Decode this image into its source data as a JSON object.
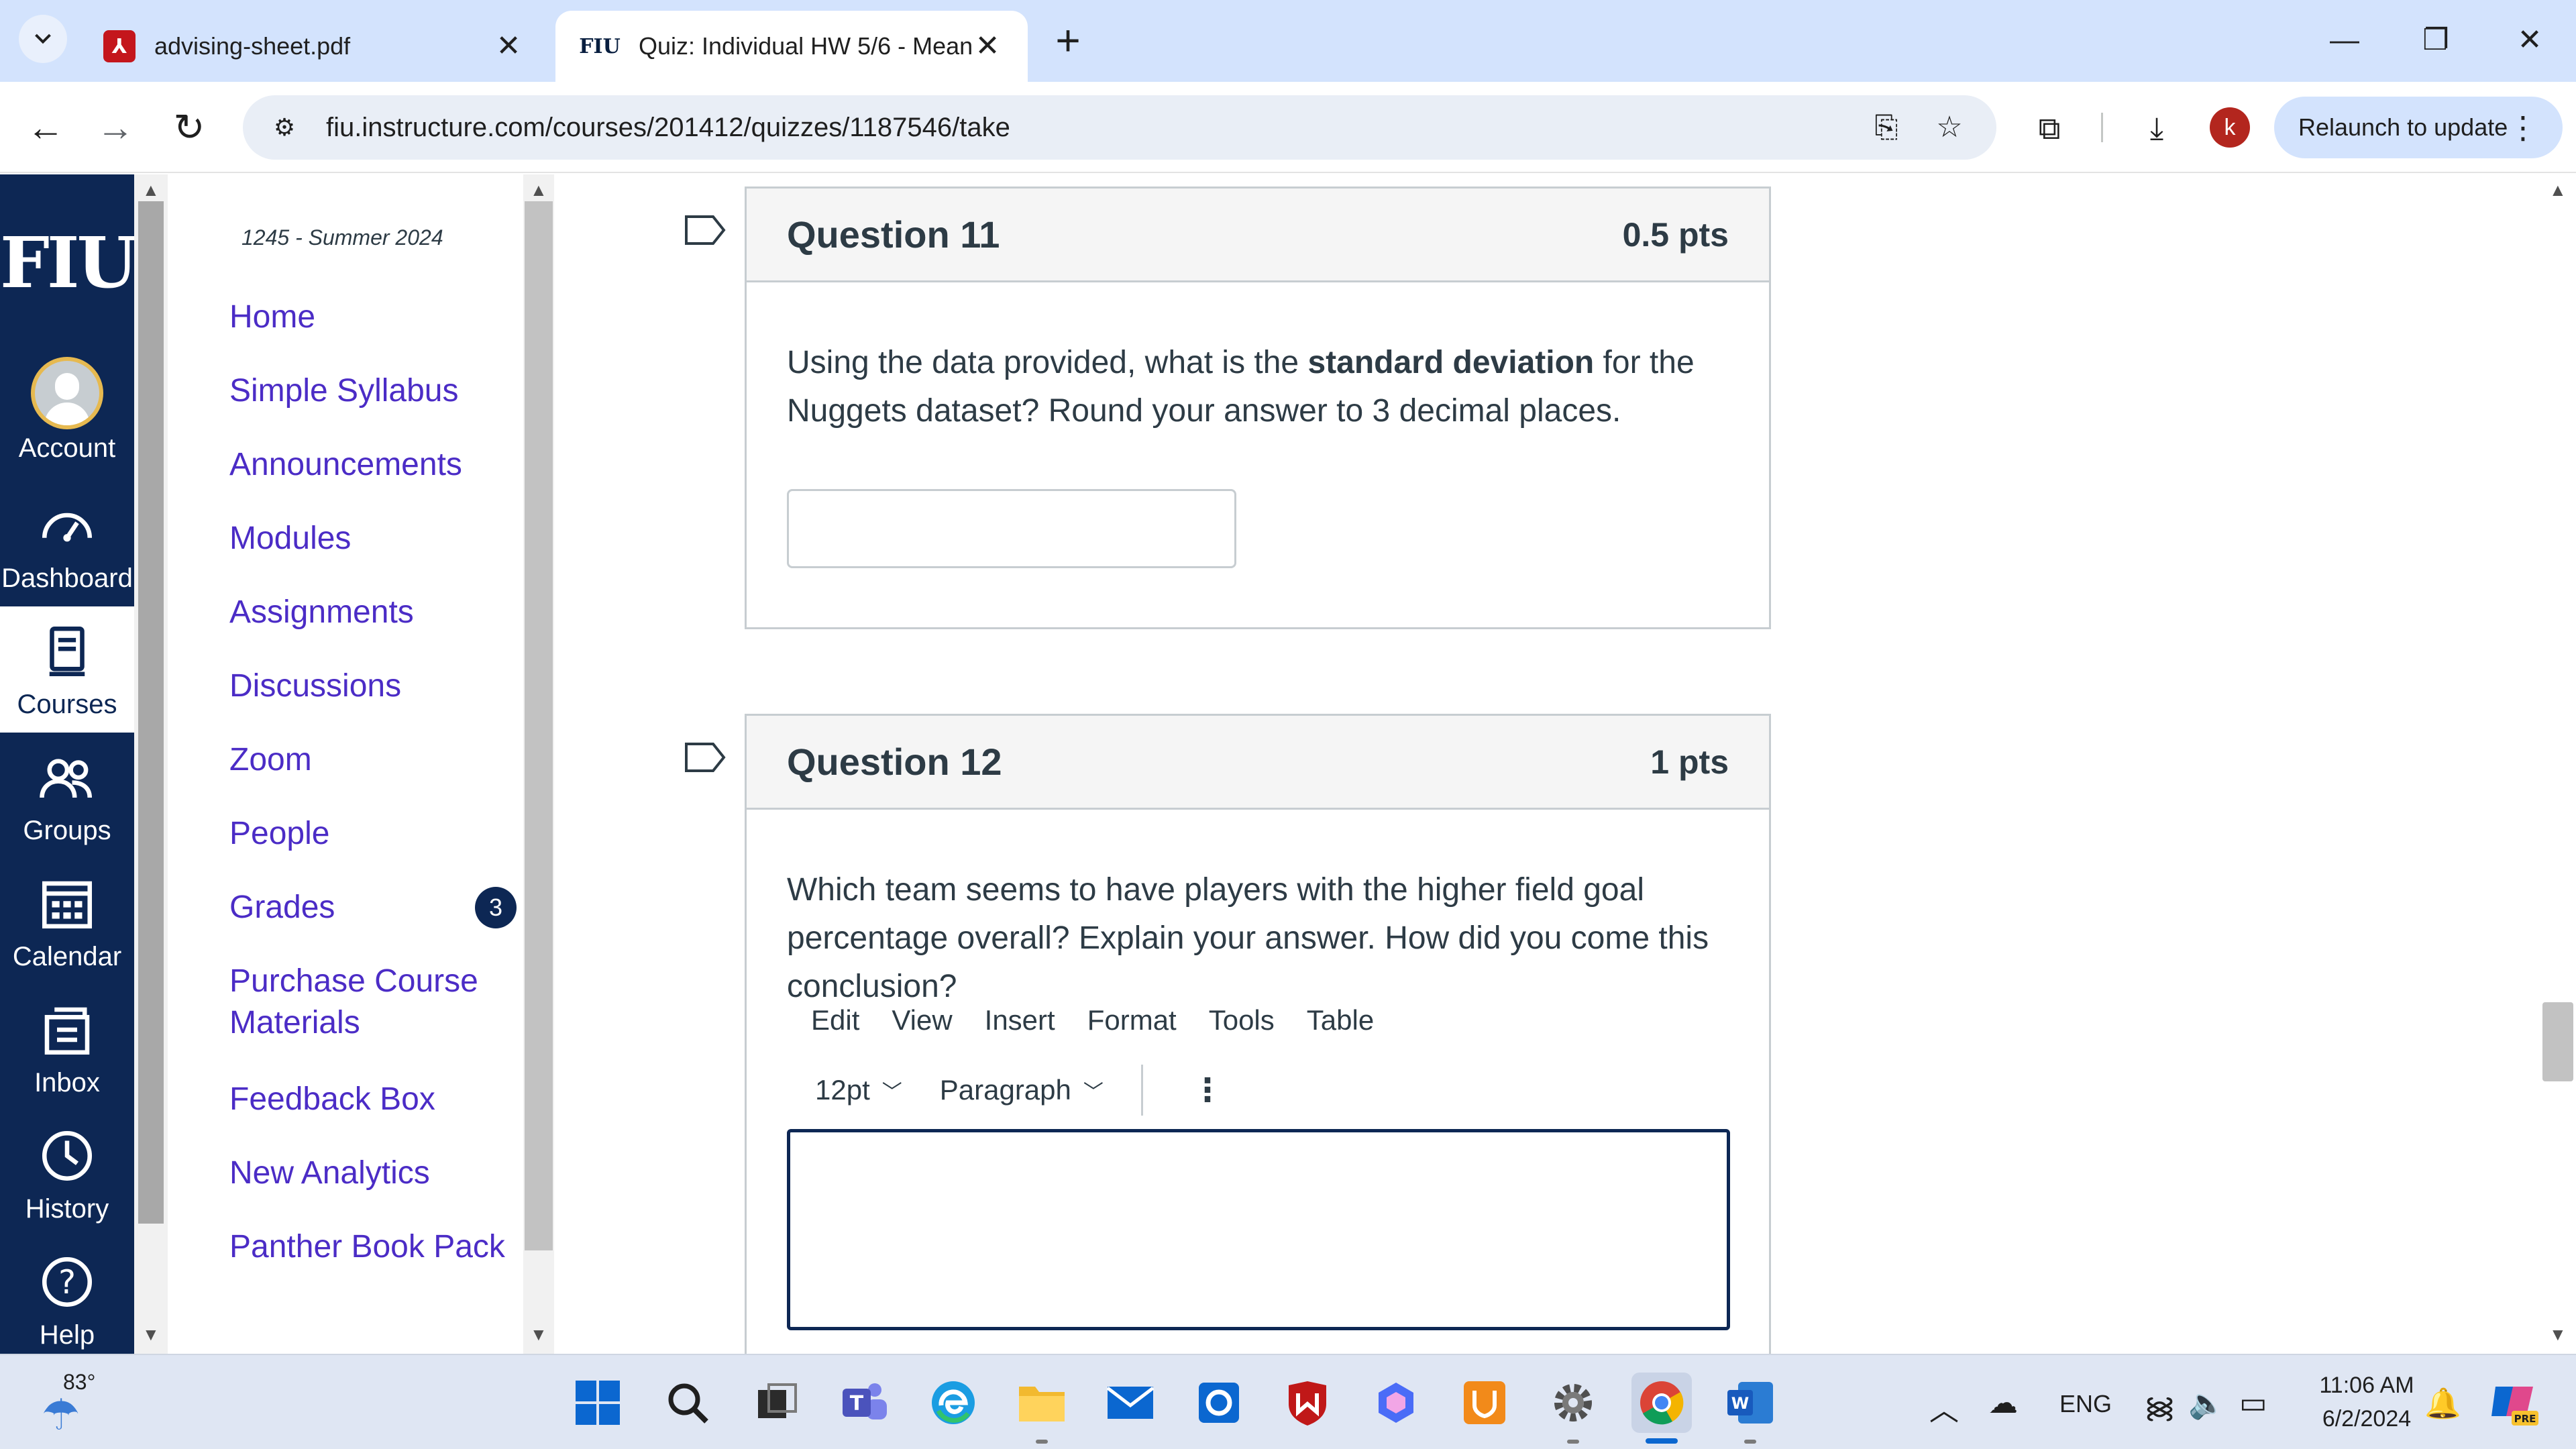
{
  "browser": {
    "tabs": [
      {
        "title": "advising-sheet.pdf",
        "favicon": "pdf-icon",
        "active": false
      },
      {
        "title": "Quiz: Individual HW 5/6 - Mean",
        "favicon": "fiu-favicon",
        "favicon_text": "FIU",
        "active": true
      }
    ],
    "new_tab_glyph": "+",
    "url": "fiu.instructure.com/courses/201412/quizzes/1187546/take",
    "profile_initial": "k",
    "relaunch_label": "Relaunch to update"
  },
  "global_nav": {
    "logo_text": "FIU",
    "items": [
      {
        "label": "Account",
        "icon": "avatar-icon"
      },
      {
        "label": "Dashboard",
        "icon": "dashboard-icon"
      },
      {
        "label": "Courses",
        "icon": "courses-icon",
        "active": true
      },
      {
        "label": "Groups",
        "icon": "groups-icon"
      },
      {
        "label": "Calendar",
        "icon": "calendar-icon"
      },
      {
        "label": "Inbox",
        "icon": "inbox-icon"
      },
      {
        "label": "History",
        "icon": "history-icon"
      },
      {
        "label": "Help",
        "icon": "help-icon"
      }
    ]
  },
  "course_nav": {
    "term": "1245 - Summer 2024",
    "links": [
      {
        "label": "Home"
      },
      {
        "label": "Simple Syllabus"
      },
      {
        "label": "Announcements"
      },
      {
        "label": "Modules"
      },
      {
        "label": "Assignments"
      },
      {
        "label": "Discussions"
      },
      {
        "label": "Zoom"
      },
      {
        "label": "People"
      },
      {
        "label": "Grades",
        "badge": "3"
      },
      {
        "label_line1": "Purchase Course",
        "label_line2": "Materials"
      },
      {
        "label": "Feedback Box"
      },
      {
        "label": "New Analytics"
      },
      {
        "label": "Panther Book Pack"
      }
    ]
  },
  "quiz": {
    "q11": {
      "title": "Question 11",
      "points": "0.5 pts",
      "text_before": "Using the data provided, what is the ",
      "text_bold": "standard deviation",
      "text_after": " for the Nuggets dataset? Round your answer to 3 decimal places.",
      "answer_value": ""
    },
    "q12": {
      "title": "Question 12",
      "points": "1 pts",
      "text": "Which team seems to have players with the higher field goal percentage overall? Explain your answer. How did you come this conclusion?",
      "editor_menu": [
        "Edit",
        "View",
        "Insert",
        "Format",
        "Tools",
        "Table"
      ],
      "font_size": "12pt",
      "block_format": "Paragraph"
    }
  },
  "taskbar": {
    "temperature": "83°",
    "language": "ENG",
    "time": "11:06 AM",
    "date": "6/2/2024",
    "copilot_badge": "PRE"
  },
  "colors": {
    "canvas_nav": "#0d2754",
    "link": "#4b2cc6",
    "tab_strip": "#d3e3fd"
  }
}
